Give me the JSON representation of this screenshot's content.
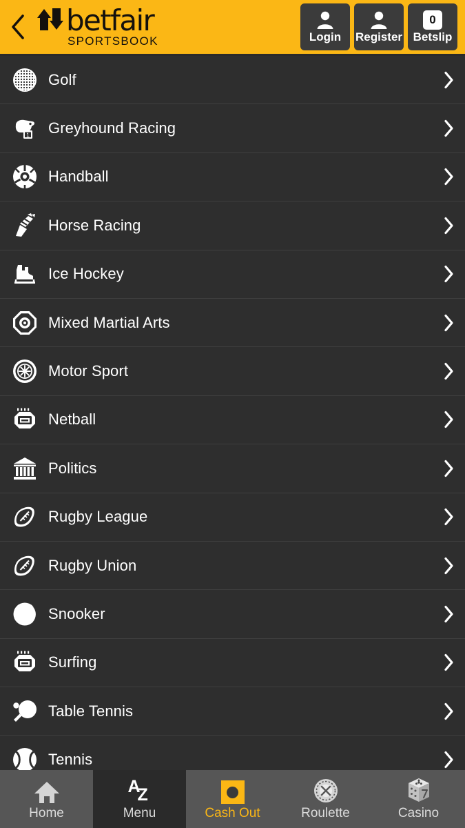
{
  "header": {
    "back_icon": "chevron-left-icon",
    "brand": "betfair",
    "brand_sub": "SPORTSBOOK",
    "brand_color": "#FBB715",
    "actions": [
      {
        "id": "login",
        "label": "Login",
        "icon": "person-icon"
      },
      {
        "id": "register",
        "label": "Register",
        "icon": "person-icon"
      },
      {
        "id": "betslip",
        "label": "Betslip",
        "icon": "betslip-count-badge",
        "count": "0"
      }
    ]
  },
  "sports_list": {
    "chevron_icon": "chevron-right-icon",
    "items": [
      {
        "label": "Golf",
        "icon": "golf-ball-icon"
      },
      {
        "label": "Greyhound Racing",
        "icon": "greyhound-dog-icon"
      },
      {
        "label": "Handball",
        "icon": "handball-ball-icon"
      },
      {
        "label": "Horse Racing",
        "icon": "horse-racing-icon"
      },
      {
        "label": "Ice Hockey",
        "icon": "ice-skate-icon"
      },
      {
        "label": "Mixed Martial Arts",
        "icon": "mma-octagon-icon"
      },
      {
        "label": "Motor Sport",
        "icon": "wheel-icon"
      },
      {
        "label": "Netball",
        "icon": "netball-court-icon"
      },
      {
        "label": "Politics",
        "icon": "parliament-building-icon"
      },
      {
        "label": "Rugby League",
        "icon": "rugby-ball-icon"
      },
      {
        "label": "Rugby Union",
        "icon": "rugby-ball-icon"
      },
      {
        "label": "Snooker",
        "icon": "snooker-ball-icon"
      },
      {
        "label": "Surfing",
        "icon": "surf-icon"
      },
      {
        "label": "Table Tennis",
        "icon": "table-tennis-paddle-icon"
      },
      {
        "label": "Tennis",
        "icon": "tennis-ball-icon"
      }
    ]
  },
  "bottom_nav": {
    "accent_color": "#FBB715",
    "items": [
      {
        "id": "home",
        "label": "Home",
        "icon": "home-icon",
        "state": "selected"
      },
      {
        "id": "menu",
        "label": "Menu",
        "icon": "a-z-icon",
        "state": "active"
      },
      {
        "id": "cash-out",
        "label": "Cash Out",
        "icon": "cashout-icon",
        "state": "highlighted"
      },
      {
        "id": "roulette",
        "label": "Roulette",
        "icon": "casino-chip-icon",
        "state": "default"
      },
      {
        "id": "casino",
        "label": "Casino",
        "icon": "dice-icon",
        "state": "default"
      }
    ]
  }
}
